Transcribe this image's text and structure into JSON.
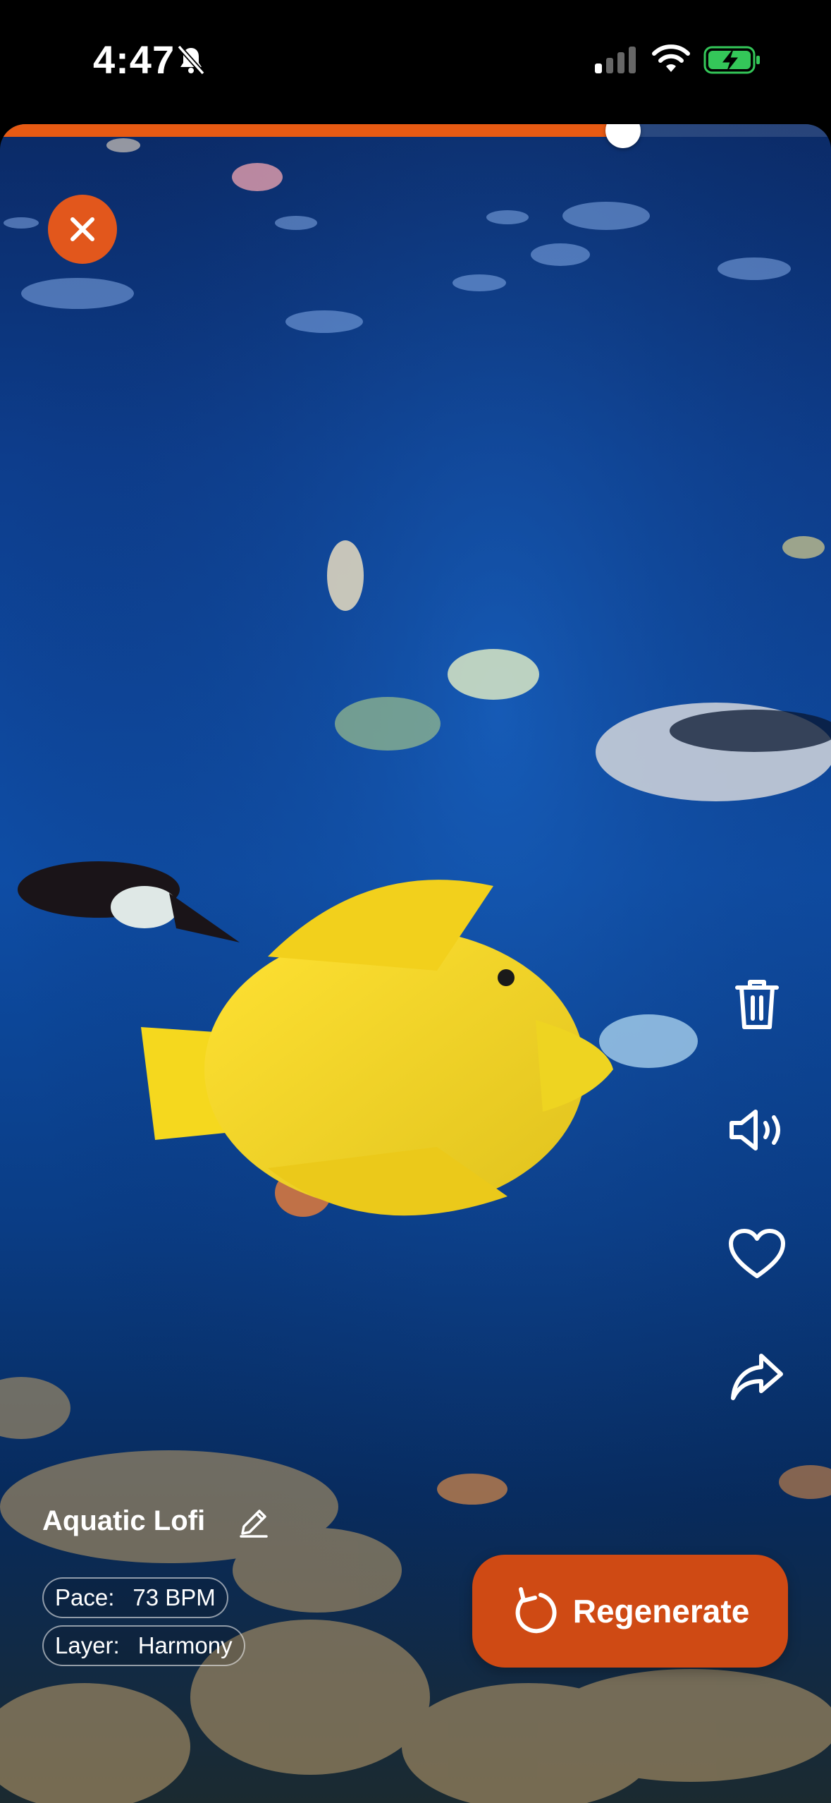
{
  "status_bar": {
    "time": "4:47",
    "icons": [
      "bell-slash-icon",
      "cellular-icon",
      "wifi-icon",
      "battery-charging-icon"
    ]
  },
  "player": {
    "progress": 0.75,
    "accent_color": "#E75A13",
    "track": {
      "title": "Aquatic Lofi"
    },
    "chips": [
      {
        "key": "Pace:",
        "value": "73 BPM"
      },
      {
        "key": "Layer:",
        "value": "Harmony"
      }
    ],
    "actions": [
      "trash-icon",
      "volume-icon",
      "heart-icon",
      "share-icon"
    ],
    "regenerate_label": "Regenerate"
  }
}
